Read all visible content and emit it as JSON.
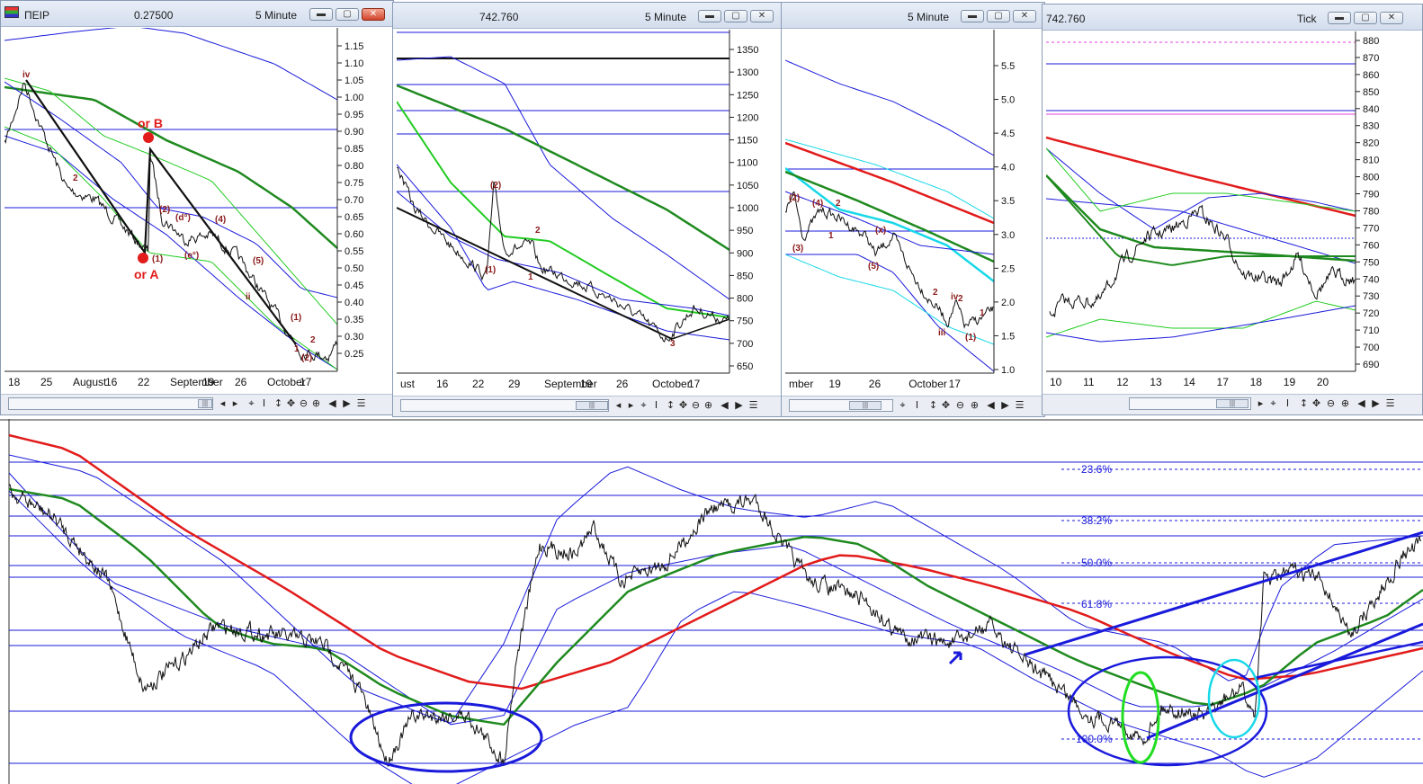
{
  "colors": {
    "blue": "#1a1adb",
    "green": "#1f8a1f",
    "lightgreen": "#22cc22",
    "red": "#e21b1b",
    "cyan": "#17d8e8",
    "annot": "#8b1a1a",
    "black": "#111111"
  },
  "windows": [
    {
      "title": "ΠΕΙΡ",
      "price": "0.27500",
      "interval": "5 Minute",
      "y_labels": [
        "1.15",
        "1.10",
        "1.05",
        "1.00",
        "0.95",
        "0.90",
        "0.85",
        "0.80",
        "0.75",
        "0.70",
        "0.65",
        "0.60",
        "0.55",
        "0.50",
        "0.45",
        "0.40",
        "0.35",
        "0.30",
        "0.25"
      ],
      "x_labels": [
        "18",
        "25",
        "August",
        "16",
        "22",
        "September",
        "19",
        "26",
        "October",
        "17"
      ],
      "annotations": [
        "iv",
        "or B",
        "or A",
        "2",
        "(2)",
        "(1)",
        "(d°)",
        "(e°)",
        "(4)",
        "(5)",
        "ii",
        "(1)",
        "(2)",
        "1",
        "2"
      ]
    },
    {
      "title": "",
      "price": "742.760",
      "interval": "5 Minute",
      "y_labels": [
        "1350",
        "1300",
        "1250",
        "1200",
        "1150",
        "1100",
        "1050",
        "1000",
        "950",
        "900",
        "850",
        "800",
        "750",
        "700",
        "650"
      ],
      "x_labels": [
        "ust",
        "16",
        "22",
        "29",
        "September",
        "19",
        "26",
        "October",
        "17"
      ],
      "annotations": [
        "(2)",
        "(1)",
        "2",
        "1",
        "3"
      ]
    },
    {
      "title": "",
      "price": "",
      "interval": "5 Minute",
      "y_labels": [
        "5.5",
        "5.0",
        "4.5",
        "4.0",
        "3.5",
        "3.0",
        "2.5",
        "2.0",
        "1.5",
        "1.0"
      ],
      "x_labels": [
        "mber",
        "19",
        "26",
        "October",
        "17"
      ],
      "annotations": [
        "(2)",
        "(4)",
        "2",
        "1",
        "(3)",
        "(x)",
        "(5)",
        "2",
        "iv",
        "2",
        "iii",
        "(1)",
        "1"
      ]
    },
    {
      "title": "",
      "price": "742.760",
      "interval": "Tick",
      "y_labels": [
        "880",
        "870",
        "860",
        "850",
        "840",
        "830",
        "820",
        "810",
        "800",
        "790",
        "780",
        "770",
        "760",
        "750",
        "740",
        "730",
        "720",
        "710",
        "700",
        "690"
      ],
      "x_labels": [
        "10",
        "11",
        "12",
        "13",
        "14",
        "17",
        "18",
        "19",
        "20"
      ],
      "annotations": []
    }
  ],
  "bottom_chart": {
    "fib_labels": [
      "23.6%",
      "38.2%",
      "50.0%",
      "61.8%",
      "100.0%"
    ]
  }
}
